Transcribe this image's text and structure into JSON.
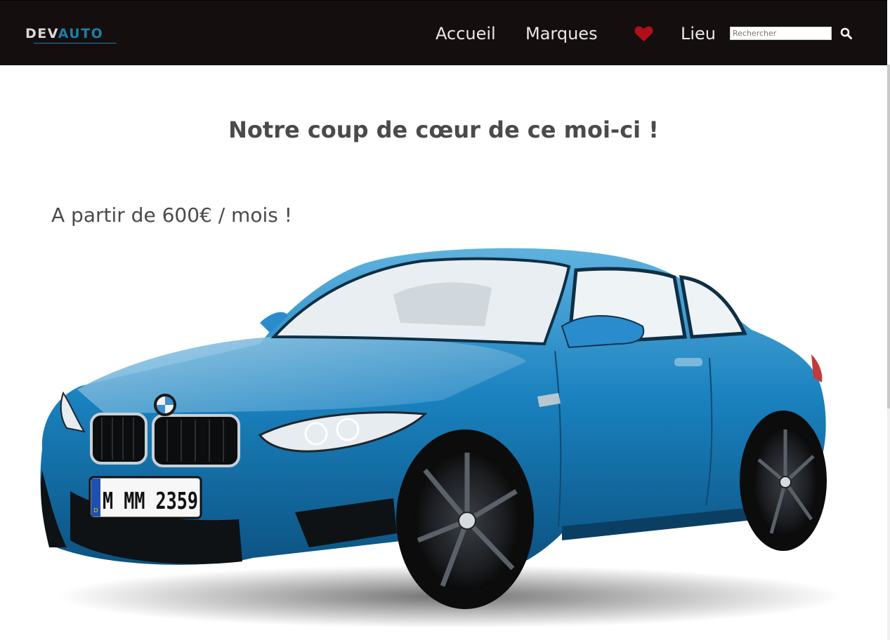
{
  "brand": {
    "part1": "DEV",
    "part2": "AUTO",
    "color_dev": "#d9d9d9",
    "color_auto": "#1b7fa8"
  },
  "nav": {
    "items": [
      {
        "label": "Accueil"
      },
      {
        "label": "Marques"
      },
      {
        "label": "Lieu"
      }
    ],
    "favorites_icon": "heart-icon",
    "search": {
      "placeholder": "Rechercher",
      "value": "",
      "icon": "search-icon"
    }
  },
  "hero": {
    "headline": "Notre coup de cœur de ce moi-ci !",
    "price": "A partir de 600€ / mois !"
  },
  "car": {
    "plate_country": "D",
    "plate_text": "M MM 2359",
    "body_color": "#1a82bf"
  },
  "colors": {
    "navbar": "#150e0e",
    "heart": "#b0101a",
    "text": "#4a4a4a"
  }
}
